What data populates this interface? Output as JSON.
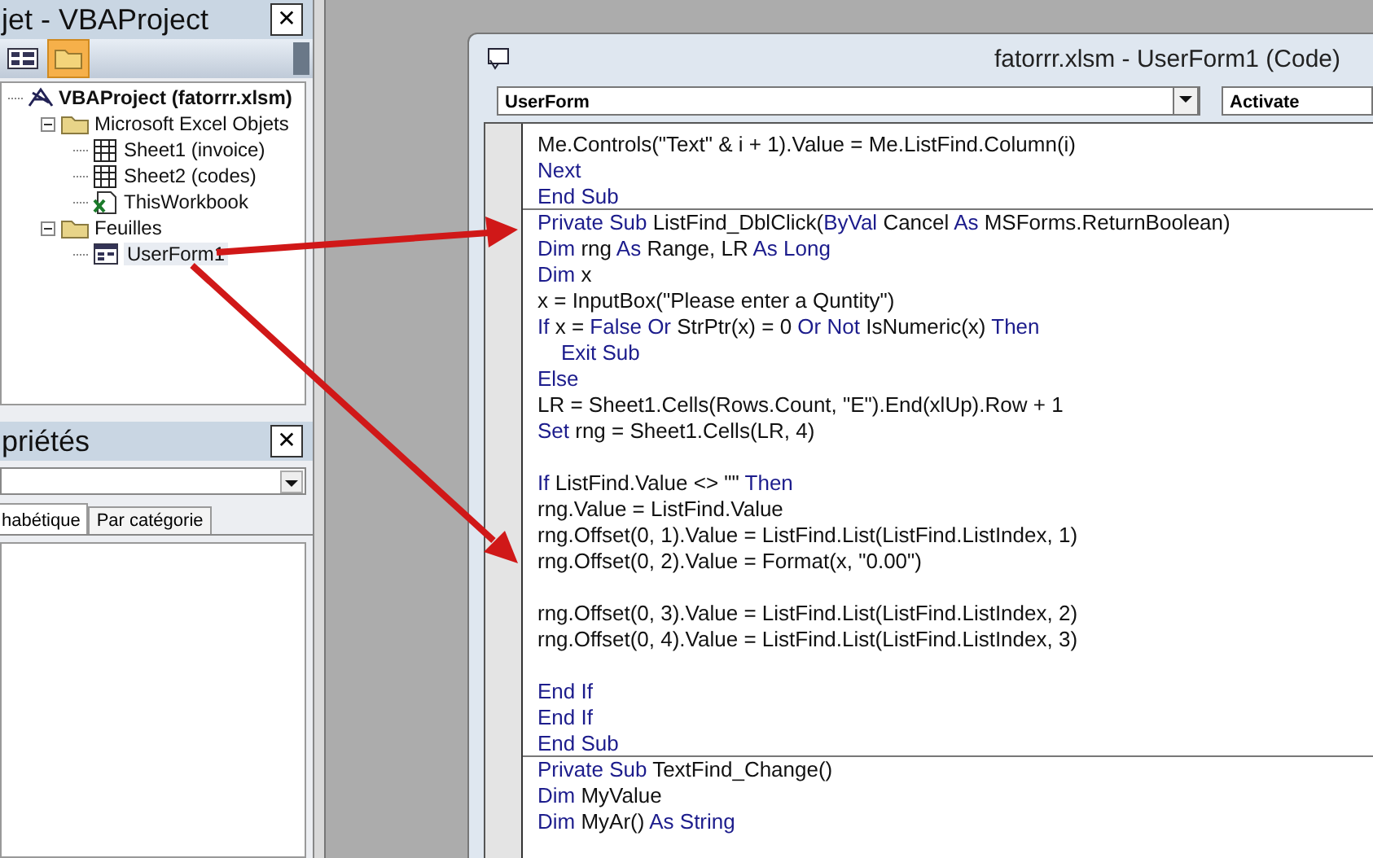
{
  "project_explorer": {
    "title": "jet - VBAProject",
    "close": "✕",
    "tree": [
      {
        "label": "VBAProject (fatorrr.xlsm)",
        "kind": "project",
        "selected": false,
        "children": [
          {
            "label": "Microsoft Excel Objets",
            "kind": "folder",
            "expanded": true,
            "selected": false,
            "children": [
              {
                "label": "Sheet1 (invoice)",
                "kind": "sheet",
                "selected": false
              },
              {
                "label": "Sheet2 (codes)",
                "kind": "sheet",
                "selected": false
              },
              {
                "label": "ThisWorkbook",
                "kind": "workbook",
                "selected": false
              }
            ]
          },
          {
            "label": "Feuilles",
            "kind": "folder",
            "expanded": true,
            "selected": false,
            "children": [
              {
                "label": "UserForm1",
                "kind": "form",
                "selected": true
              }
            ]
          }
        ]
      }
    ]
  },
  "properties": {
    "title": "priétés",
    "close": "✕",
    "tabs": [
      {
        "label": "habétique",
        "selected": true
      },
      {
        "label": "Par catégorie",
        "selected": false
      }
    ]
  },
  "code_window": {
    "title": "fatorrr.xlsm - UserForm1 (Code)",
    "object_box": "UserForm",
    "procedure_box": "Activate",
    "lines": [
      {
        "kind": "code",
        "segments": [
          {
            "text": "Me.Controls(\"Text\" & i + 1).Value = Me.ListFind.Column(i)",
            "keyword": false
          }
        ]
      },
      {
        "kind": "code",
        "segments": [
          {
            "text": "Next",
            "keyword": true
          }
        ]
      },
      {
        "kind": "code",
        "segments": [
          {
            "text": "End Sub",
            "keyword": true
          }
        ]
      },
      {
        "kind": "procedure",
        "segments": [
          {
            "text": "Private Sub",
            "keyword": true
          },
          {
            "text": " ListFind_DblClick(",
            "keyword": false
          },
          {
            "text": "ByVal",
            "keyword": true
          },
          {
            "text": " Cancel ",
            "keyword": false
          },
          {
            "text": "As",
            "keyword": true
          },
          {
            "text": " MSForms.ReturnBoolean)",
            "keyword": false
          }
        ]
      },
      {
        "kind": "code",
        "segments": [
          {
            "text": "Dim",
            "keyword": true
          },
          {
            "text": " rng ",
            "keyword": false
          },
          {
            "text": "As",
            "keyword": true
          },
          {
            "text": " Range, LR ",
            "keyword": false
          },
          {
            "text": "As Long",
            "keyword": true
          }
        ]
      },
      {
        "kind": "code",
        "segments": [
          {
            "text": "Dim",
            "keyword": true
          },
          {
            "text": " x",
            "keyword": false
          }
        ]
      },
      {
        "kind": "code",
        "segments": [
          {
            "text": "x = InputBox(\"Please enter a Quntity\")",
            "keyword": false
          }
        ]
      },
      {
        "kind": "code",
        "segments": [
          {
            "text": "If",
            "keyword": true
          },
          {
            "text": " x = ",
            "keyword": false
          },
          {
            "text": "False Or",
            "keyword": true
          },
          {
            "text": " StrPtr(x) = 0 ",
            "keyword": false
          },
          {
            "text": "Or Not",
            "keyword": true
          },
          {
            "text": " IsNumeric(x) ",
            "keyword": false
          },
          {
            "text": "Then",
            "keyword": true
          }
        ]
      },
      {
        "kind": "code",
        "segments": [
          {
            "text": "    Exit Sub",
            "keyword": true
          }
        ]
      },
      {
        "kind": "code",
        "segments": [
          {
            "text": "Else",
            "keyword": true
          }
        ]
      },
      {
        "kind": "code",
        "segments": [
          {
            "text": "LR = Sheet1.Cells(Rows.Count, \"E\").End(xlUp).Row + 1",
            "keyword": false
          }
        ]
      },
      {
        "kind": "code",
        "segments": [
          {
            "text": "Set",
            "keyword": true
          },
          {
            "text": " rng = Sheet1.Cells(LR, 4)",
            "keyword": false
          }
        ]
      },
      {
        "kind": "blank"
      },
      {
        "kind": "code",
        "segments": [
          {
            "text": "If",
            "keyword": true
          },
          {
            "text": " ListFind.Value <> \"\" ",
            "keyword": false
          },
          {
            "text": "Then",
            "keyword": true
          }
        ]
      },
      {
        "kind": "code",
        "segments": [
          {
            "text": "rng.Value = ListFind.Value",
            "keyword": false
          }
        ]
      },
      {
        "kind": "code",
        "segments": [
          {
            "text": "rng.Offset(0, 1).Value = ListFind.List(ListFind.ListIndex, 1)",
            "keyword": false
          }
        ]
      },
      {
        "kind": "code",
        "segments": [
          {
            "text": "rng.Offset(0, 2).Value = Format(x, \"0.00\")",
            "keyword": false
          }
        ]
      },
      {
        "kind": "blank"
      },
      {
        "kind": "code",
        "segments": [
          {
            "text": "rng.Offset(0, 3).Value = ListFind.List(ListFind.ListIndex, 2)",
            "keyword": false
          }
        ]
      },
      {
        "kind": "code",
        "segments": [
          {
            "text": "rng.Offset(0, 4).Value = ListFind.List(ListFind.ListIndex, 3)",
            "keyword": false
          }
        ]
      },
      {
        "kind": "blank"
      },
      {
        "kind": "code",
        "segments": [
          {
            "text": "End If",
            "keyword": true
          }
        ]
      },
      {
        "kind": "code",
        "segments": [
          {
            "text": "End If",
            "keyword": true
          }
        ]
      },
      {
        "kind": "code",
        "segments": [
          {
            "text": "End Sub",
            "keyword": true
          }
        ]
      },
      {
        "kind": "procedure",
        "segments": [
          {
            "text": "Private Sub",
            "keyword": true
          },
          {
            "text": " TextFind_Change()",
            "keyword": false
          }
        ]
      },
      {
        "kind": "code",
        "segments": [
          {
            "text": "Dim",
            "keyword": true
          },
          {
            "text": " MyValue",
            "keyword": false
          }
        ]
      },
      {
        "kind": "code",
        "segments": [
          {
            "text": "Dim",
            "keyword": true
          },
          {
            "text": " MyAr() ",
            "keyword": false
          },
          {
            "text": "As String",
            "keyword": true
          }
        ]
      }
    ]
  }
}
